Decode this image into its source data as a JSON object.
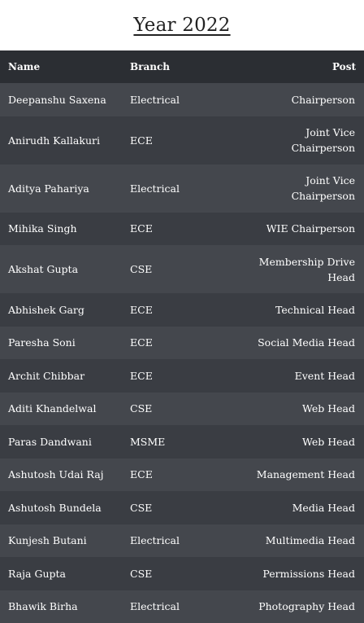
{
  "page": {
    "title": "Year 2022"
  },
  "table": {
    "headers": {
      "name": "Name",
      "branch": "Branch",
      "post": "Post"
    },
    "rows": [
      {
        "name": "Deepanshu Saxena",
        "branch": "Electrical",
        "post": "Chairperson"
      },
      {
        "name": "Anirudh Kallakuri",
        "branch": "ECE",
        "post": "Joint Vice Chairperson"
      },
      {
        "name": "Aditya Pahariya",
        "branch": "Electrical",
        "post": "Joint Vice Chairperson"
      },
      {
        "name": "Mihika Singh",
        "branch": "ECE",
        "post": "WIE Chairperson"
      },
      {
        "name": "Akshat Gupta",
        "branch": "CSE",
        "post": "Membership Drive Head"
      },
      {
        "name": "Abhishek Garg",
        "branch": "ECE",
        "post": "Technical Head"
      },
      {
        "name": "Paresha Soni",
        "branch": "ECE",
        "post": "Social Media Head"
      },
      {
        "name": "Archit Chibbar",
        "branch": "ECE",
        "post": "Event Head"
      },
      {
        "name": "Aditi Khandelwal",
        "branch": "CSE",
        "post": "Web Head"
      },
      {
        "name": "Paras Dandwani",
        "branch": "MSME",
        "post": "Web Head"
      },
      {
        "name": "Ashutosh Udai Raj",
        "branch": "ECE",
        "post": "Management Head"
      },
      {
        "name": "Ashutosh Bundela",
        "branch": "CSE",
        "post": "Media Head"
      },
      {
        "name": "Kunjesh Butani",
        "branch": "Electrical",
        "post": "Multimedia Head"
      },
      {
        "name": "Raja Gupta",
        "branch": "CSE",
        "post": "Permissions Head"
      },
      {
        "name": "Bhawik Birha",
        "branch": "Electrical",
        "post": "Photography Head"
      }
    ]
  },
  "colors": {
    "header_bg": "#2b2e33",
    "row_dark": "#3a3d43",
    "row_light": "#44474d",
    "text": "#ffffff"
  }
}
